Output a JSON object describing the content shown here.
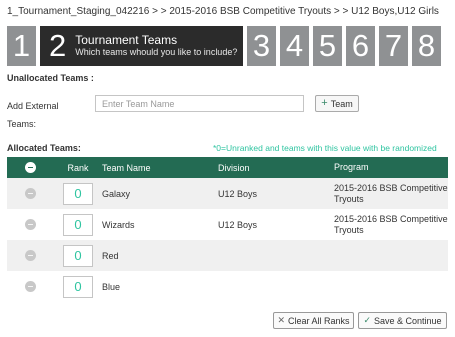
{
  "breadcrumb": "1_Tournament_Staging_042216 > > 2015-2016 BSB Competitive Tryouts > > U12 Boys,U12 Girls",
  "steps": {
    "before": [
      "1"
    ],
    "active": {
      "number": "2",
      "title": "Tournament Teams",
      "subtitle": "Which teams whould you like to include?"
    },
    "after": [
      "3",
      "4",
      "5",
      "6",
      "7",
      "8"
    ]
  },
  "unallocated": {
    "heading": "Unallocated Teams :",
    "external_label": "Add External Teams:",
    "input_placeholder": "Enter Team Name",
    "input_value": "",
    "add_button": "Team",
    "add_button_icon": "plus-icon"
  },
  "allocated": {
    "heading": "Allocated Teams:",
    "note": "*0=Unranked and teams with this value with be randomized",
    "columns": {
      "rank": "Rank",
      "team_name": "Team Name",
      "division": "Division",
      "program": "Program"
    },
    "rows": [
      {
        "rank": "0",
        "team_name": "Galaxy",
        "division": "U12 Boys",
        "program": "2015-2016 BSB Competitive Tryouts"
      },
      {
        "rank": "0",
        "team_name": "Wizards",
        "division": "U12 Boys",
        "program": "2015-2016 BSB Competitive Tryouts"
      },
      {
        "rank": "0",
        "team_name": "Red",
        "division": "",
        "program": ""
      },
      {
        "rank": "0",
        "team_name": "Blue",
        "division": "",
        "program": ""
      }
    ]
  },
  "buttons": {
    "clear_all_ranks": "Clear All Ranks",
    "save_continue": "Save & Continue"
  },
  "colors": {
    "header_green": "#236b53",
    "accent_teal": "#2ec4a0",
    "step_gray": "#8f9193",
    "step_active": "#2b2b2b"
  }
}
